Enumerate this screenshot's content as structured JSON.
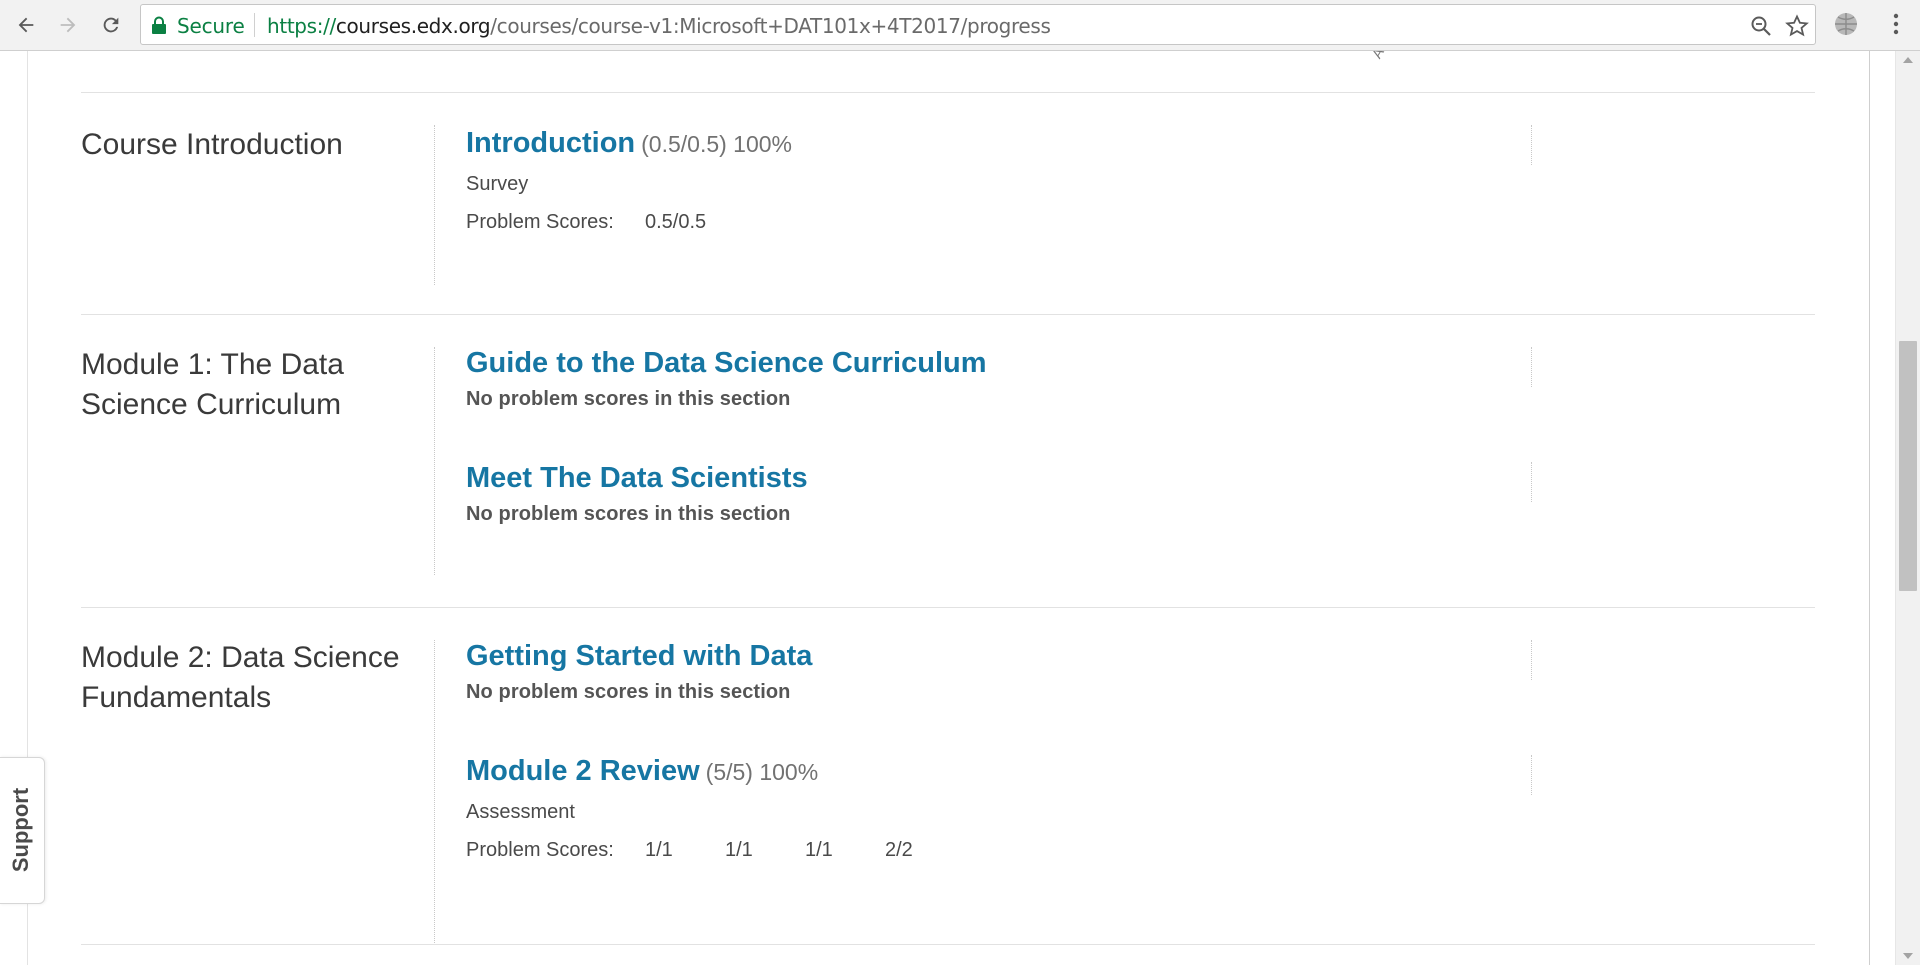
{
  "browser": {
    "secure_label": "Secure",
    "url_scheme": "https://",
    "url_host": "courses.edx.org",
    "url_path": "/courses/course-v1:Microsoft+DAT101x+4T2017/progress"
  },
  "chapters": [
    {
      "title": "Course Introduction",
      "sections": [
        {
          "title": "Introduction",
          "score": "(0.5/0.5) 100%",
          "format": "Survey",
          "problem_scores_label": "Problem Scores:",
          "problem_scores": [
            "0.5/0.5"
          ]
        }
      ]
    },
    {
      "title": "Module 1: The Data Science Curriculum",
      "sections": [
        {
          "title": "Guide to the Data Science Curriculum",
          "no_scores": "No problem scores in this section"
        },
        {
          "title": "Meet The Data Scientists",
          "no_scores": "No problem scores in this section"
        }
      ]
    },
    {
      "title": "Module 2: Data Science Fundamentals",
      "sections": [
        {
          "title": "Getting Started with Data",
          "no_scores": "No problem scores in this section"
        },
        {
          "title": "Module 2 Review",
          "score": "(5/5) 100%",
          "format": "Assessment",
          "problem_scores_label": "Problem Scores:",
          "problem_scores": [
            "1/1",
            "1/1",
            "1/1",
            "2/2"
          ]
        }
      ]
    }
  ],
  "support": {
    "label": "Support"
  },
  "colors": {
    "link": "#1676a3",
    "secure": "#0b8043"
  }
}
